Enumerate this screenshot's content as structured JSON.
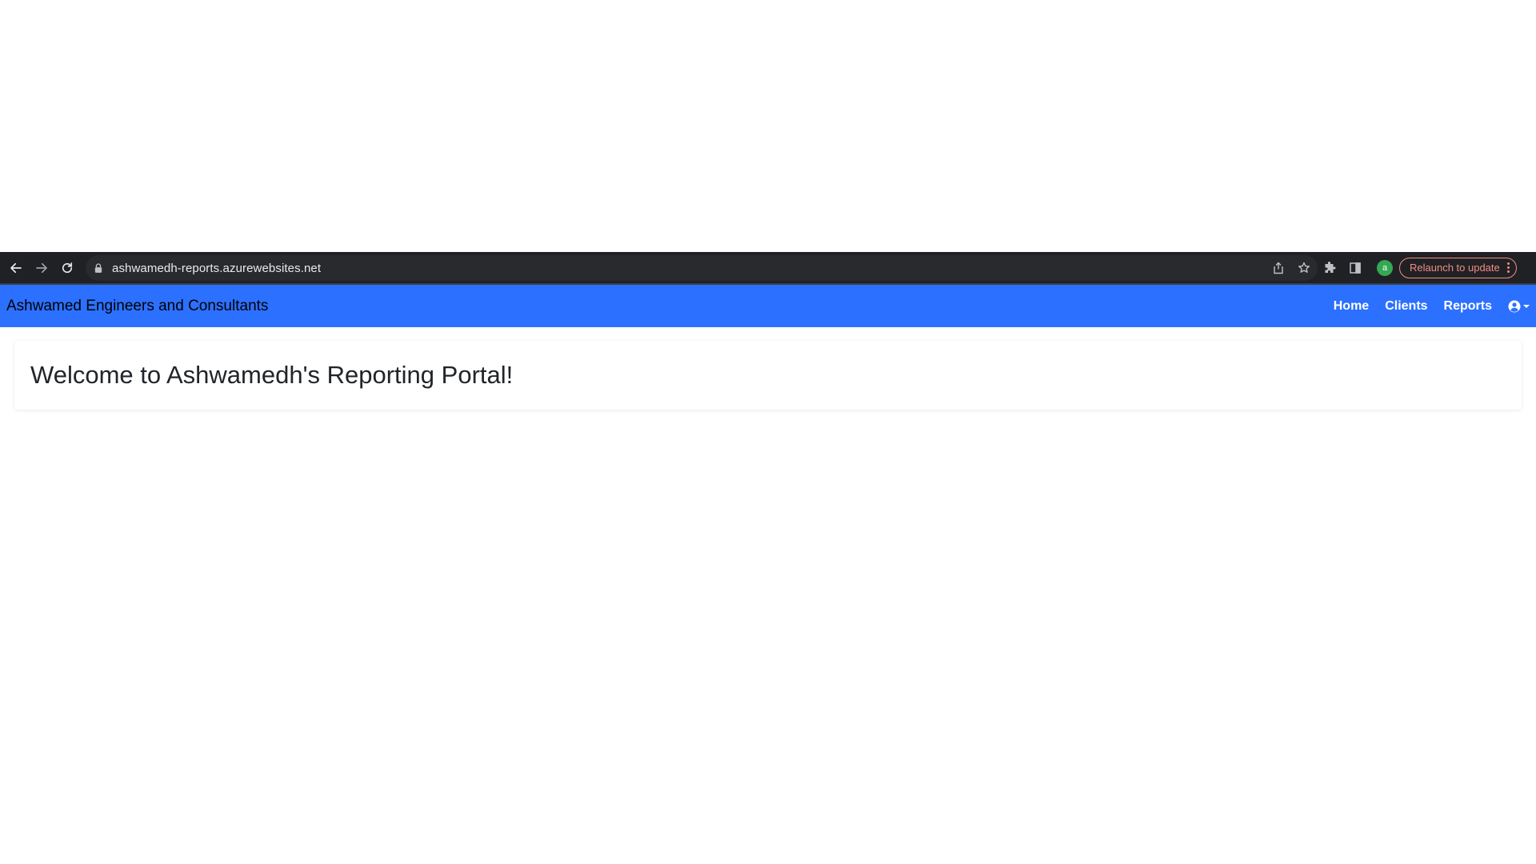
{
  "browser": {
    "url": "ashwamedh-reports.azurewebsites.net",
    "profile_initial": "a",
    "relaunch_label": "Relaunch to update",
    "icons": [
      "back-arrow-icon",
      "forward-arrow-icon",
      "reload-icon",
      "lock-icon",
      "share-icon",
      "star-icon",
      "puzzle-icon",
      "side-panel-icon",
      "kebab-menu-icon"
    ]
  },
  "navbar": {
    "brand": "Ashwamed Engineers and Consultants",
    "links": [
      {
        "label": "Home"
      },
      {
        "label": "Clients"
      },
      {
        "label": "Reports"
      }
    ],
    "user_icon": "user-circle-icon",
    "bg_color": "#2c70ff"
  },
  "main": {
    "welcome": "Welcome to Ashwamedh's Reporting Portal!"
  }
}
